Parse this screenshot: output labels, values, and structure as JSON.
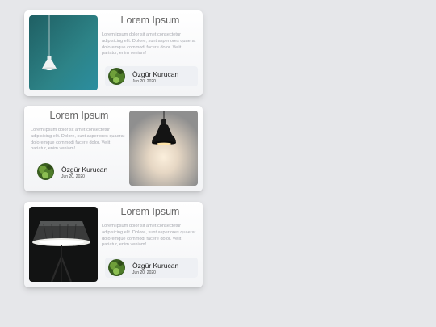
{
  "cards": [
    {
      "title": "Lorem Ipsum",
      "body": "Lorem ipsum dolor sit amet consectetur adipisicing elit. Dolore, sunt asperiores quaerat doloremque commodi facere dolor. Velit pariatur, enim veniam!",
      "author": {
        "name": "Özgür Kurucan",
        "date": "Jun 20, 2020"
      },
      "image": "pendant-lamp-teal",
      "image_side": "left"
    },
    {
      "title": "Lorem Ipsum",
      "body": "Lorem ipsum dolor sit amet consectetur adipisicing elit. Dolore, sunt asperiores quaerat doloremque commodi facere dolor. Velit pariatur, enim veniam!",
      "author": {
        "name": "Özgür Kurucan",
        "date": "Jun 20, 2020"
      },
      "image": "pendant-lamp-lit",
      "image_side": "right"
    },
    {
      "title": "Lorem Ipsum",
      "body": "Lorem ipsum dolor sit amet consectetur adipisicing elit. Dolore, sunt asperiores quaerat doloremque commodi facere dolor. Velit pariatur, enim veniam!",
      "author": {
        "name": "Özgür Kurucan",
        "date": "Jun 20, 2020"
      },
      "image": "floor-lamp-dark",
      "image_side": "left"
    }
  ],
  "colors": {
    "background": "#e6e7ea",
    "title": "#666666",
    "body_text": "#a7a9b0",
    "author_bg": "#eef0f4"
  }
}
